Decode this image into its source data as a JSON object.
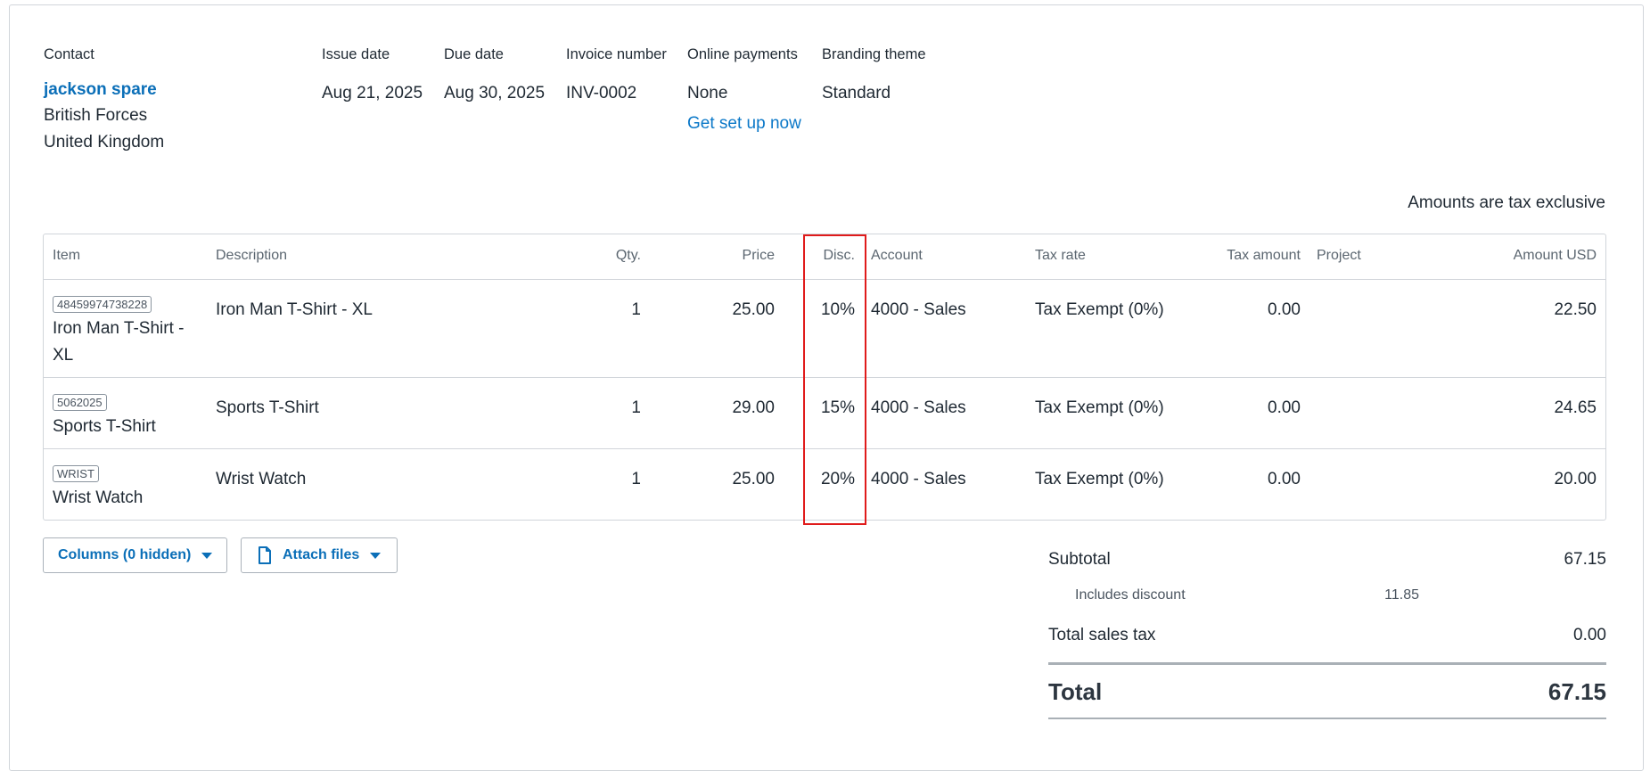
{
  "header": {
    "contact_label": "Contact",
    "contact_name": "jackson spare",
    "contact_address": [
      "British Forces",
      "United Kingdom"
    ],
    "issue_date_label": "Issue date",
    "issue_date": "Aug 21, 2025",
    "due_date_label": "Due date",
    "due_date": "Aug 30, 2025",
    "invoice_number_label": "Invoice number",
    "invoice_number": "INV-0002",
    "online_payments_label": "Online payments",
    "online_payments": "None",
    "online_payments_link": "Get set up now",
    "branding_label": "Branding theme",
    "branding": "Standard"
  },
  "tax_note": "Amounts are tax exclusive",
  "table": {
    "columns": {
      "item": "Item",
      "description": "Description",
      "qty": "Qty.",
      "price": "Price",
      "disc": "Disc.",
      "account": "Account",
      "tax_rate": "Tax rate",
      "tax_amount": "Tax amount",
      "project": "Project",
      "amount": "Amount USD"
    },
    "rows": [
      {
        "sku": "48459974738228",
        "item": "Iron Man T-Shirt - XL",
        "description": "Iron Man T-Shirt - XL",
        "qty": "1",
        "price": "25.00",
        "disc": "10%",
        "account": "4000 - Sales",
        "tax_rate": "Tax Exempt (0%)",
        "tax_amount": "0.00",
        "project": "",
        "amount": "22.50"
      },
      {
        "sku": "5062025",
        "item": "Sports T-Shirt",
        "description": "Sports T-Shirt",
        "qty": "1",
        "price": "29.00",
        "disc": "15%",
        "account": "4000 - Sales",
        "tax_rate": "Tax Exempt (0%)",
        "tax_amount": "0.00",
        "project": "",
        "amount": "24.65"
      },
      {
        "sku": "WRIST",
        "item": "Wrist Watch",
        "description": "Wrist Watch",
        "qty": "1",
        "price": "25.00",
        "disc": "20%",
        "account": "4000 - Sales",
        "tax_rate": "Tax Exempt (0%)",
        "tax_amount": "0.00",
        "project": "",
        "amount": "20.00"
      }
    ]
  },
  "buttons": {
    "columns": "Columns (0 hidden)",
    "attach": "Attach files"
  },
  "totals": {
    "subtotal_label": "Subtotal",
    "subtotal": "67.15",
    "discount_label": "Includes discount",
    "discount": "11.85",
    "tax_label": "Total sales tax",
    "tax": "0.00",
    "total_label": "Total",
    "total": "67.15"
  },
  "colors": {
    "link": "#0b6fb8",
    "highlight": "#e01b1b",
    "border": "#d1d5da"
  }
}
